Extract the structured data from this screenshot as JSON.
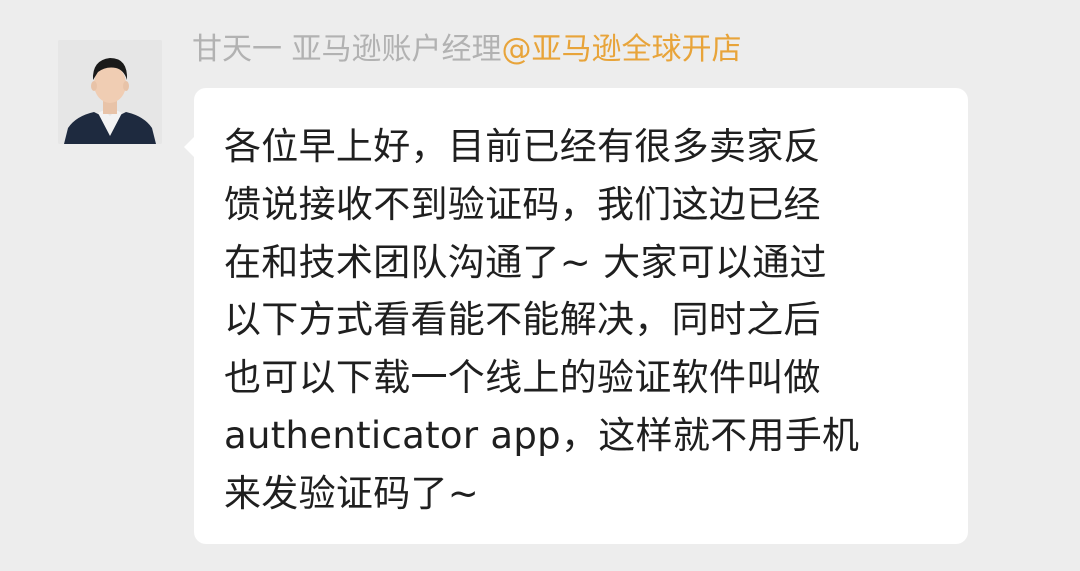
{
  "chat": {
    "sender_name": "甘天一 亚马逊账户经理",
    "sender_group": "@亚马逊全球开店",
    "avatar_icon": "person-avatar-icon",
    "message_lines": [
      "各位早上好，目前已经有很多卖家反",
      "馈说接收不到验证码，我们这边已经",
      "在和技术团队沟通了~ 大家可以通过",
      "以下方式看看能不能解决，同时之后",
      "也可以下载一个线上的验证软件叫做",
      "authenticator app，这样就不用手机",
      "来发验证码了~"
    ]
  },
  "colors": {
    "background": "#ededed",
    "bubble": "#ffffff",
    "sender_name": "#b2b2b2",
    "sender_group": "#e8a43a",
    "message_text": "#1f1f1f"
  }
}
